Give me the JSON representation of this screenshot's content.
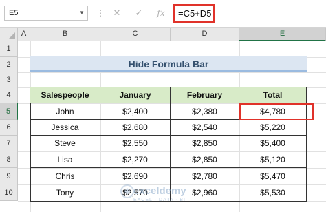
{
  "formula_bar": {
    "name_box": "E5",
    "formula": "=C5+D5",
    "cancel_icon": "✕",
    "enter_icon": "✓",
    "fx_icon": "fx"
  },
  "columns": [
    "A",
    "B",
    "C",
    "D",
    "E"
  ],
  "rows": [
    "1",
    "2",
    "3",
    "4",
    "5",
    "6",
    "7",
    "8",
    "9",
    "10"
  ],
  "selected": {
    "column": "E",
    "row": "5"
  },
  "title": "Hide Formula Bar",
  "table": {
    "headers": [
      "Salespeople",
      "January",
      "February",
      "Total"
    ],
    "rows": [
      [
        "John",
        "$2,400",
        "$2,380",
        "$4,780"
      ],
      [
        "Jessica",
        "$2,680",
        "$2,540",
        "$5,220"
      ],
      [
        "Steve",
        "$2,550",
        "$2,850",
        "$5,400"
      ],
      [
        "Lisa",
        "$2,270",
        "$2,850",
        "$5,120"
      ],
      [
        "Chris",
        "$2,690",
        "$2,780",
        "$5,470"
      ],
      [
        "Tony",
        "$2,570",
        "$2,960",
        "$5,530"
      ]
    ]
  },
  "watermark": {
    "brand": "exceldemy",
    "tagline": "EXCEL · DATA · BI"
  },
  "colors": {
    "highlight": "#e0322a",
    "header_fill": "#d8ebc8",
    "title_fill": "#dce6f2",
    "selected_accent": "#217346"
  }
}
